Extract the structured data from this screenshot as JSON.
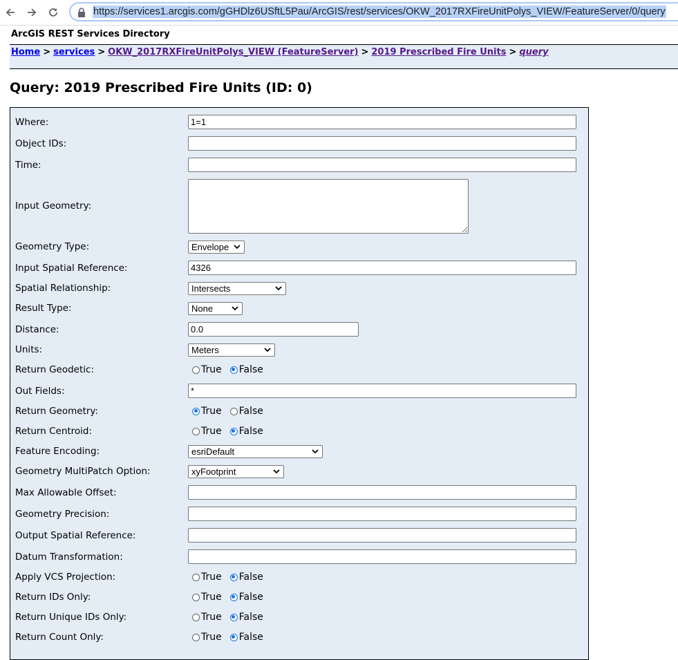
{
  "browser": {
    "url": "https://services1.arcgis.com/gGHDlz6USftL5Pau/ArcGIS/rest/services/OKW_2017RXFireUnitPolys_VIEW/FeatureServer/0/query",
    "icons": {
      "back": "arrow-left",
      "forward": "arrow-right",
      "reload": "reload",
      "lock": "lock"
    }
  },
  "directory_title": "ArcGIS REST Services Directory",
  "breadcrumb": {
    "items": [
      "Home",
      "services",
      "OKW_2017RXFireUnitPolys_VIEW (FeatureServer)",
      "2019 Prescribed Fire Units",
      "query"
    ],
    "separator": ">"
  },
  "page_title": "Query: 2019 Prescribed Fire Units (ID: 0)",
  "form": {
    "where": {
      "label": "Where:",
      "value": "1=1"
    },
    "object_ids": {
      "label": "Object IDs:",
      "value": ""
    },
    "time": {
      "label": "Time:",
      "value": ""
    },
    "input_geometry": {
      "label": "Input Geometry:",
      "value": ""
    },
    "geometry_type": {
      "label": "Geometry Type:",
      "selected": "Envelope"
    },
    "input_sr": {
      "label": "Input Spatial Reference:",
      "value": "4326"
    },
    "spatial_rel": {
      "label": "Spatial Relationship:",
      "selected": "Intersects"
    },
    "result_type": {
      "label": "Result Type:",
      "selected": "None"
    },
    "distance": {
      "label": "Distance:",
      "value": "0.0"
    },
    "units": {
      "label": "Units:",
      "selected": "Meters"
    },
    "return_geodetic": {
      "label": "Return Geodetic:",
      "true_label": "True",
      "false_label": "False",
      "value": false
    },
    "out_fields": {
      "label": "Out Fields:",
      "value": "*"
    },
    "return_geometry": {
      "label": "Return Geometry:",
      "true_label": "True",
      "false_label": "False",
      "value": true
    },
    "return_centroid": {
      "label": "Return Centroid:",
      "true_label": "True",
      "false_label": "False",
      "value": false
    },
    "feature_encoding": {
      "label": "Feature Encoding:",
      "selected": "esriDefault"
    },
    "multipatch_option": {
      "label": "Geometry MultiPatch Option:",
      "selected": "xyFootprint"
    },
    "max_allowable_offset": {
      "label": "Max Allowable Offset:",
      "value": ""
    },
    "geometry_precision": {
      "label": "Geometry Precision:",
      "value": ""
    },
    "output_sr": {
      "label": "Output Spatial Reference:",
      "value": ""
    },
    "datum_transformation": {
      "label": "Datum Transformation:",
      "value": ""
    },
    "apply_vcs": {
      "label": "Apply VCS Projection:",
      "true_label": "True",
      "false_label": "False",
      "value": false
    },
    "return_ids_only": {
      "label": "Return IDs Only:",
      "true_label": "True",
      "false_label": "False",
      "value": false
    },
    "return_unique_ids_only": {
      "label": "Return Unique IDs Only:",
      "true_label": "True",
      "false_label": "False",
      "value": false
    },
    "return_count_only": {
      "label": "Return Count Only:",
      "true_label": "True",
      "false_label": "False",
      "value": false
    }
  }
}
